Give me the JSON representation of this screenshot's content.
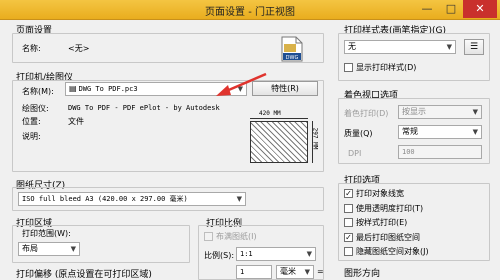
{
  "window": {
    "title": "页面设置 - 门正视图",
    "minimize": "—",
    "maximize": "□",
    "close": "✕"
  },
  "page_setup": {
    "group_title": "页面设置",
    "name_label": "名称:",
    "name_value": "<无>"
  },
  "printer": {
    "group_title": "打印机/绘图仪",
    "name_label": "名称(M):",
    "name_value": "DWG To PDF.pc3",
    "properties_button": "特性(R)",
    "plotter_label": "绘图仪:",
    "plotter_value": "DWG To PDF - PDF ePlot - by Autodesk",
    "location_label": "位置:",
    "location_value": "文件",
    "description_label": "说明:",
    "width_dim": "420 MM",
    "height_dim": "297 MM"
  },
  "paper_size": {
    "group_title": "图纸尺寸(Z)",
    "value": "ISO full bleed A3 (420.00 x 297.00 毫米)"
  },
  "plot_area": {
    "group_title": "打印区域",
    "range_label": "打印范围(W):",
    "range_value": "布局"
  },
  "plot_offset": {
    "label": "打印偏移 (原点设置在可打印区域)"
  },
  "plot_scale": {
    "group_title": "打印比例",
    "fit_label": "布满图纸(I)",
    "scale_label": "比例(S):",
    "scale_value": "1:1",
    "units_value": "1",
    "units_name": "毫米",
    "equals": "="
  },
  "plot_style_table": {
    "group_title": "打印样式表(画笔指定)(G)",
    "value": "无",
    "display_label": "显示打印样式(D)"
  },
  "shaded_viewport": {
    "group_title": "着色视口选项",
    "shade_label": "着色打印(D)",
    "shade_value": "按显示",
    "quality_label": "质量(Q)",
    "quality_value": "常规",
    "dpi_label": "DPI",
    "dpi_value": "100"
  },
  "plot_options": {
    "group_title": "打印选项",
    "items": [
      {
        "label": "打印对象线宽",
        "checked": true,
        "enabled": true
      },
      {
        "label": "使用透明度打印(T)",
        "checked": false,
        "enabled": true
      },
      {
        "label": "按样式打印(E)",
        "checked": false,
        "enabled": true
      },
      {
        "label": "最后打印图纸空间",
        "checked": true,
        "enabled": true
      },
      {
        "label": "隐藏图纸空间对象(J)",
        "checked": false,
        "enabled": true
      }
    ]
  },
  "drawing_orientation": {
    "group_title": "图形方向"
  }
}
